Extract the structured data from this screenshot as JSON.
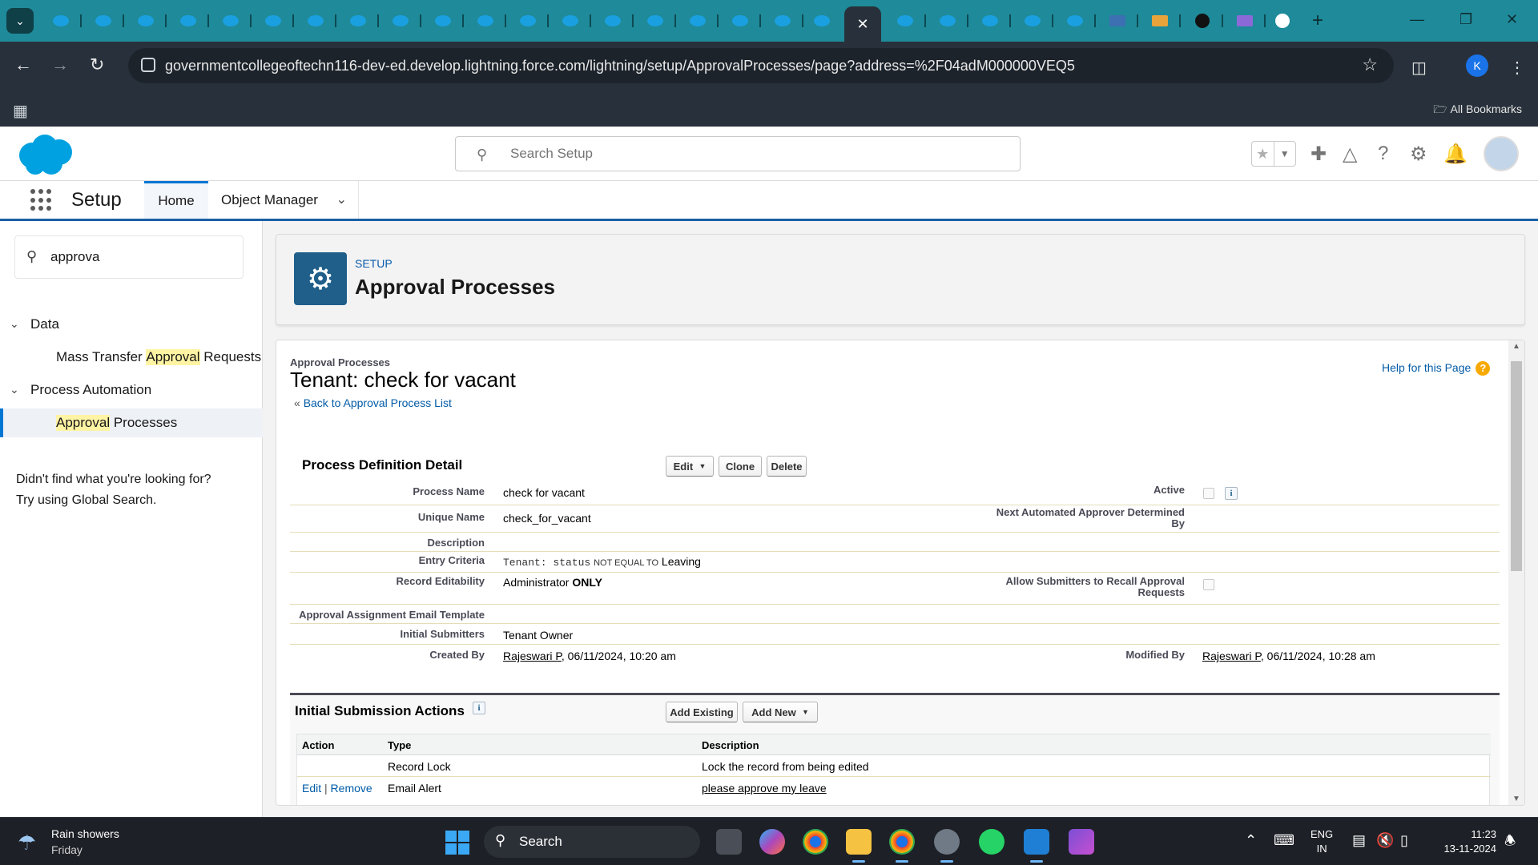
{
  "browser": {
    "active_tab_close": "✕",
    "url": "governmentcollegeoftechn116-dev-ed.develop.lightning.force.com/lightning/setup/ApprovalProcesses/page?address=%2F04adM000000VEQ5",
    "all_bookmarks": "All Bookmarks",
    "profile_initial": "K"
  },
  "sf_header": {
    "search_placeholder": "Search Setup"
  },
  "sf_nav": {
    "app_name": "Setup",
    "home": "Home",
    "object_manager": "Object Manager"
  },
  "sidebar": {
    "quickfind_value": "approva",
    "sections": [
      {
        "label": "Data",
        "items": [
          {
            "pre": "Mass Transfer ",
            "hl": "Approval",
            "post": " Requests"
          }
        ]
      },
      {
        "label": "Process Automation",
        "items": [
          {
            "pre": "",
            "hl": "Approval",
            "post": " Processes"
          }
        ]
      }
    ],
    "help_line1": "Didn't find what you're looking for?",
    "help_line2": "Try using Global Search."
  },
  "page_header": {
    "eyebrow": "SETUP",
    "title": "Approval Processes"
  },
  "detail": {
    "breadcrumb": "Approval Processes",
    "title": "Tenant: check for vacant",
    "back_prefix": "«",
    "back_link": "Back to Approval Process List",
    "help_link": "Help for this Page",
    "help_icon": "?",
    "section_title": "Process Definition Detail",
    "buttons": {
      "edit": "Edit",
      "clone": "Clone",
      "delete": "Delete"
    },
    "fields": {
      "process_name_label": "Process Name",
      "process_name": "check for vacant",
      "active_label": "Active",
      "unique_name_label": "Unique Name",
      "unique_name": "check_for_vacant",
      "next_approver_label_1": "Next Automated Approver Determined",
      "next_approver_label_2": "By",
      "description_label": "Description",
      "entry_criteria_label": "Entry Criteria",
      "entry_criteria_field": "Tenant: status",
      "entry_criteria_op": "NOT EQUAL TO",
      "entry_criteria_value": "Leaving",
      "record_edit_label": "Record Editability",
      "record_edit_value": "Administrator",
      "record_edit_bold": "ONLY",
      "recall_label_1": "Allow Submitters to Recall Approval",
      "recall_label_2": "Requests",
      "email_template_label": "Approval Assignment Email Template",
      "initial_submitters_label": "Initial Submitters",
      "initial_submitters": "Tenant Owner",
      "created_by_label": "Created By",
      "created_by_user": "Rajeswari P",
      "created_by_date": ", 06/11/2024, 10:20 am",
      "modified_by_label": "Modified By",
      "modified_by_user": "Rajeswari P",
      "modified_by_date": ", 06/11/2024, 10:28 am"
    },
    "isa": {
      "title": "Initial Submission Actions",
      "add_existing": "Add Existing",
      "add_new": "Add New",
      "columns": [
        "Action",
        "Type",
        "Description"
      ],
      "rows": [
        {
          "edit": "",
          "remove": "",
          "sep": "",
          "type": "Record Lock",
          "description": "Lock the record from being edited"
        },
        {
          "edit": "Edit",
          "remove": "Remove",
          "sep": "|",
          "type": "Email Alert",
          "description": "please approve my leave"
        }
      ]
    }
  },
  "taskbar": {
    "weather_text": "Rain showers",
    "weather_day": "Friday",
    "search": "Search",
    "lang_1": "ENG",
    "lang_2": "IN",
    "time": "11:23",
    "date": "13-11-2024"
  }
}
